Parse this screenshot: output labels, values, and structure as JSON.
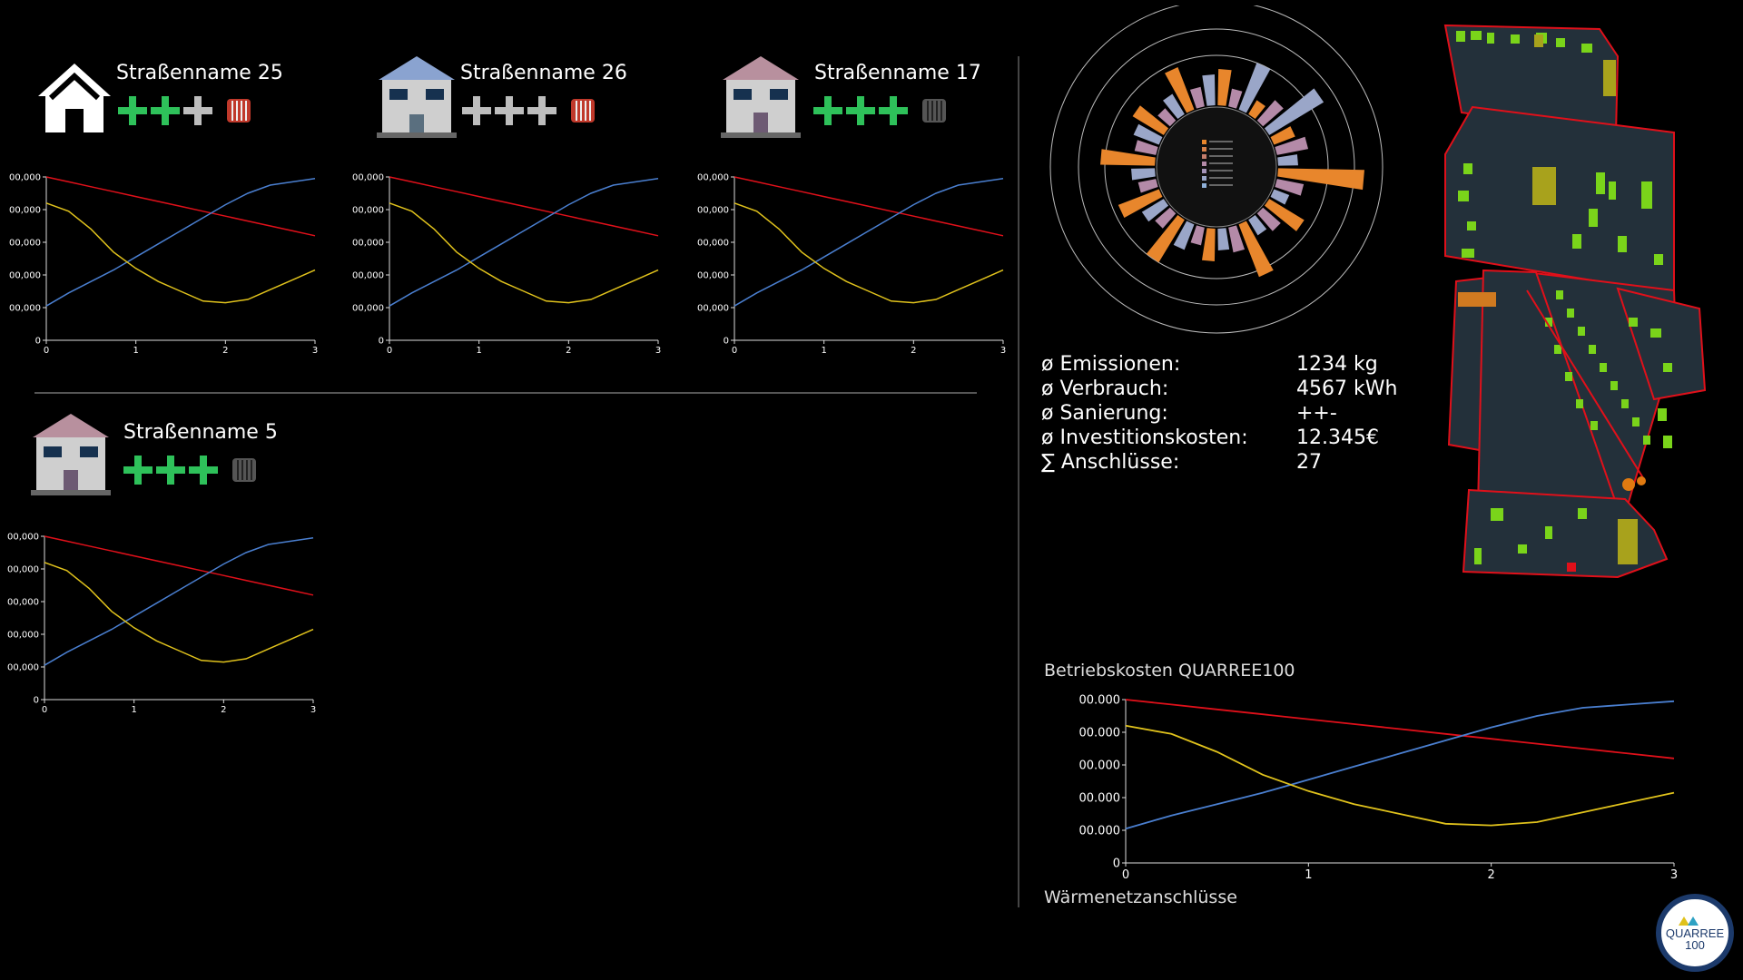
{
  "houses": [
    {
      "title": "Straßenname 25",
      "rating": [
        true,
        true,
        false
      ],
      "heating": "radiator-red-icon",
      "style": "white-icon"
    },
    {
      "title": "Straßenname 26",
      "rating": [
        false,
        false,
        false
      ],
      "heating": "radiator-red-icon",
      "style": "blue-roof"
    },
    {
      "title": "Straßenname 17",
      "rating": [
        true,
        true,
        true
      ],
      "heating": "radiator-gray-icon",
      "style": "pink-roof"
    },
    {
      "title": "Straßenname 5",
      "rating": [
        true,
        true,
        true
      ],
      "heating": "radiator-gray-icon",
      "style": "pink-roof"
    }
  ],
  "small_chart_ticks": {
    "y": [
      "0",
      "00,000",
      "00,000",
      "00,000",
      "00,000",
      "00,000"
    ],
    "x": [
      "0",
      "1",
      "2",
      "3"
    ]
  },
  "stats": [
    {
      "label": "ø Emissionen:",
      "value": "1234 kg"
    },
    {
      "label": "ø Verbrauch:",
      "value": "4567 kWh"
    },
    {
      "label": "ø Sanierung:",
      "value": "++-"
    },
    {
      "label": "ø Investitionskosten:",
      "value": "12.345€"
    },
    {
      "label": "∑ Anschlüsse:",
      "value": "27"
    }
  ],
  "main_chart": {
    "title": "Betriebskosten QUARREE100",
    "xlabel": "Wärmenetzanschlüsse",
    "y_ticks": [
      "0",
      "00.000",
      "00.000",
      "00.000",
      "00.000",
      "00.000"
    ],
    "x_ticks": [
      "0",
      "1",
      "2",
      "3"
    ]
  },
  "logo": {
    "line1": "QUARREE",
    "line2": "100"
  },
  "colors": {
    "red": "#e0101a",
    "blue": "#4a7fd0",
    "yellow": "#e0c21c",
    "green": "#2ec15a",
    "map_bg": "#23303a"
  },
  "chart_data": [
    {
      "type": "line",
      "x": [
        0,
        0.25,
        0.5,
        0.75,
        1.0,
        1.25,
        1.5,
        1.75,
        2.0,
        2.25,
        2.5,
        2.75,
        3.0
      ],
      "ylim": [
        0,
        5
      ],
      "xlim": [
        0,
        3
      ],
      "series": [
        {
          "color": "#e0101a",
          "values": [
            5.0,
            4.85,
            4.7,
            4.55,
            4.4,
            4.25,
            4.1,
            3.95,
            3.8,
            3.65,
            3.5,
            3.35,
            3.2
          ]
        },
        {
          "color": "#4a7fd0",
          "values": [
            1.05,
            1.45,
            1.8,
            2.15,
            2.55,
            2.95,
            3.35,
            3.75,
            4.15,
            4.5,
            4.75,
            4.85,
            4.95
          ]
        },
        {
          "color": "#e0c21c",
          "values": [
            4.2,
            3.95,
            3.4,
            2.7,
            2.2,
            1.8,
            1.5,
            1.2,
            1.15,
            1.25,
            1.55,
            1.85,
            2.15
          ]
        }
      ]
    }
  ]
}
